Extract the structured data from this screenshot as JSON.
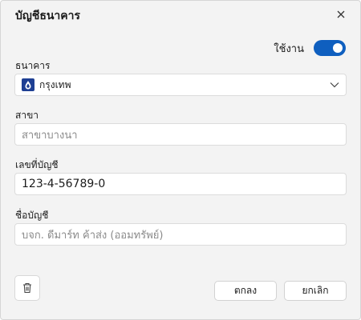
{
  "dialog": {
    "title": "บัญชีธนาคาร",
    "close_icon": "close-icon"
  },
  "status": {
    "label": "ใช้งาน",
    "enabled": true
  },
  "bank": {
    "label": "ธนาคาร",
    "selected": "กรุงเทพ",
    "icon": "bank-logo-icon"
  },
  "branch": {
    "label": "สาขา",
    "placeholder": "สาขาบางนา",
    "value": ""
  },
  "account_number": {
    "label": "เลขที่บัญชี",
    "value": "123-4-56789-0"
  },
  "account_name": {
    "label": "ชื่อบัญชี",
    "placeholder": "บจก. ดีมาร์ท ค้าส่ง (ออมทรัพย์)",
    "value": ""
  },
  "actions": {
    "delete_icon": "trash-icon",
    "ok_label": "ตกลง",
    "cancel_label": "ยกเลิก"
  },
  "colors": {
    "accent": "#0f5fbf",
    "bank_brand": "#1e3f93"
  }
}
